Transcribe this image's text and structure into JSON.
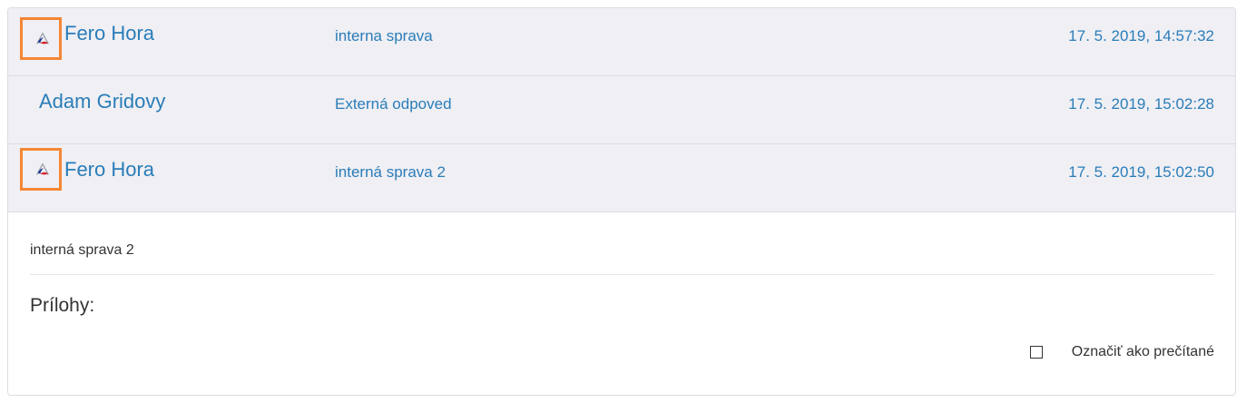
{
  "messages": [
    {
      "sender": "Fero Hora",
      "subject": "interna sprava",
      "timestamp": "17. 5. 2019, 14:57:32",
      "internal": true,
      "logo_icon": "company-logo-icon"
    },
    {
      "sender": "Adam Gridovy",
      "subject": "Externá odpoved",
      "timestamp": "17. 5. 2019, 15:02:28",
      "internal": false
    },
    {
      "sender": "Fero Hora",
      "subject": "interná sprava 2",
      "timestamp": "17. 5. 2019, 15:02:50",
      "internal": true,
      "logo_icon": "company-logo-icon"
    }
  ],
  "detail": {
    "body": "interná sprava 2",
    "attachments_heading": "Prílohy:",
    "mark_read_label": "Označiť ako prečítané",
    "mark_read_checked": false
  },
  "colors": {
    "link": "#2a7db8",
    "row_background": "#efeff4",
    "highlight_border": "#f58634",
    "text": "#333333"
  }
}
